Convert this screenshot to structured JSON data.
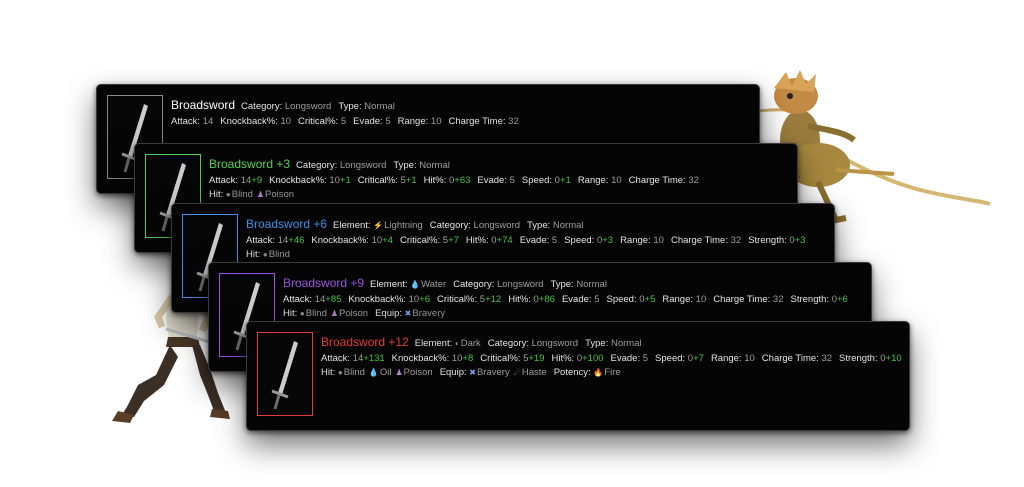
{
  "colors": {
    "bonus": "#43c443",
    "plus0": "#ffffff",
    "plus3": "#4fd14f",
    "plus6": "#3e8fe6",
    "plus9": "#9a52e0",
    "plus12": "#e33b3b"
  },
  "cards": [
    {
      "title": "Broadsword",
      "rarity": "plus0",
      "header": [
        {
          "label": "Category:",
          "value": "Longsword"
        },
        {
          "label": "Type:",
          "value": "Normal"
        }
      ],
      "stats": [
        {
          "label": "Attack:",
          "base": "14"
        },
        {
          "label": "Knockback%:",
          "base": "10"
        },
        {
          "label": "Critical%:",
          "base": "5"
        },
        {
          "label": "Evade:",
          "base": "5"
        },
        {
          "label": "Range:",
          "base": "10"
        },
        {
          "label": "Charge Time:",
          "base": "32"
        }
      ],
      "extras": []
    },
    {
      "title": "Broadsword +3",
      "rarity": "plus3",
      "header": [
        {
          "label": "Category:",
          "value": "Longsword"
        },
        {
          "label": "Type:",
          "value": "Normal"
        }
      ],
      "stats": [
        {
          "label": "Attack:",
          "base": "14",
          "bonus": "+9"
        },
        {
          "label": "Knockback%:",
          "base": "10",
          "bonus": "+1"
        },
        {
          "label": "Critical%:",
          "base": "5",
          "bonus": "+1"
        },
        {
          "label": "Hit%:",
          "base": "0",
          "bonus": "+63"
        },
        {
          "label": "Evade:",
          "base": "5"
        },
        {
          "label": "Speed:",
          "base": "0",
          "bonus": "+1"
        },
        {
          "label": "Range:",
          "base": "10"
        },
        {
          "label": "Charge Time:",
          "base": "32"
        }
      ],
      "extras": [
        {
          "label": "Hit:",
          "items": [
            {
              "icon": "blind-icon",
              "glyph": "●",
              "color": "#8a8a9a",
              "text": "Blind"
            },
            {
              "icon": "poison-icon",
              "glyph": "♟",
              "color": "#b184c8",
              "text": "Poison"
            }
          ]
        }
      ]
    },
    {
      "title": "Broadsword +6",
      "rarity": "plus6",
      "header": [
        {
          "label": "Element:",
          "value": "Lightning",
          "icon": "lightning-icon",
          "glyph": "⚡",
          "color": "#e8d84a"
        },
        {
          "label": "Category:",
          "value": "Longsword"
        },
        {
          "label": "Type:",
          "value": "Normal"
        }
      ],
      "stats": [
        {
          "label": "Attack:",
          "base": "14",
          "bonus": "+46"
        },
        {
          "label": "Knockback%:",
          "base": "10",
          "bonus": "+4"
        },
        {
          "label": "Critical%:",
          "base": "5",
          "bonus": "+7"
        },
        {
          "label": "Hit%:",
          "base": "0",
          "bonus": "+74"
        },
        {
          "label": "Evade:",
          "base": "5"
        },
        {
          "label": "Speed:",
          "base": "0",
          "bonus": "+3"
        },
        {
          "label": "Range:",
          "base": "10"
        },
        {
          "label": "Charge Time:",
          "base": "32"
        },
        {
          "label": "Strength:",
          "base": "0",
          "bonus": "+3"
        }
      ],
      "extras": [
        {
          "label": "Hit:",
          "items": [
            {
              "icon": "blind-icon",
              "glyph": "●",
              "color": "#8a8a9a",
              "text": "Blind"
            }
          ]
        }
      ]
    },
    {
      "title": "Broadsword +9",
      "rarity": "plus9",
      "header": [
        {
          "label": "Element:",
          "value": "Water",
          "icon": "water-icon",
          "glyph": "💧",
          "color": "#5aa8ee"
        },
        {
          "label": "Category:",
          "value": "Longsword"
        },
        {
          "label": "Type:",
          "value": "Normal"
        }
      ],
      "stats": [
        {
          "label": "Attack:",
          "base": "14",
          "bonus": "+85"
        },
        {
          "label": "Knockback%:",
          "base": "10",
          "bonus": "+6"
        },
        {
          "label": "Critical%:",
          "base": "5",
          "bonus": "+12"
        },
        {
          "label": "Hit%:",
          "base": "0",
          "bonus": "+86"
        },
        {
          "label": "Evade:",
          "base": "5"
        },
        {
          "label": "Speed:",
          "base": "0",
          "bonus": "+5"
        },
        {
          "label": "Range:",
          "base": "10"
        },
        {
          "label": "Charge Time:",
          "base": "32"
        },
        {
          "label": "Strength:",
          "base": "0",
          "bonus": "+6"
        }
      ],
      "extras": [
        {
          "label": "Hit:",
          "items": [
            {
              "icon": "blind-icon",
              "glyph": "●",
              "color": "#8a8a9a",
              "text": "Blind"
            },
            {
              "icon": "poison-icon",
              "glyph": "♟",
              "color": "#b184c8",
              "text": "Poison"
            }
          ]
        },
        {
          "label": "Equip:",
          "items": [
            {
              "icon": "bravery-icon",
              "glyph": "✖",
              "color": "#6fa0e8",
              "text": "Bravery"
            }
          ]
        }
      ]
    },
    {
      "title": "Broadsword +12",
      "rarity": "plus12",
      "header": [
        {
          "label": "Element:",
          "value": "Dark",
          "icon": "dark-icon",
          "glyph": "◐",
          "color": "#8c8cc8"
        },
        {
          "label": "Category:",
          "value": "Longsword"
        },
        {
          "label": "Type:",
          "value": "Normal"
        }
      ],
      "stats": [
        {
          "label": "Attack:",
          "base": "14",
          "bonus": "+131"
        },
        {
          "label": "Knockback%:",
          "base": "10",
          "bonus": "+8"
        },
        {
          "label": "Critical%:",
          "base": "5",
          "bonus": "+19"
        },
        {
          "label": "Hit%:",
          "base": "0",
          "bonus": "+100"
        },
        {
          "label": "Evade:",
          "base": "5"
        },
        {
          "label": "Speed:",
          "base": "0",
          "bonus": "+7"
        },
        {
          "label": "Range:",
          "base": "10"
        },
        {
          "label": "Charge Time:",
          "base": "32"
        },
        {
          "label": "Strength:",
          "base": "0",
          "bonus": "+10"
        }
      ],
      "extras": [
        {
          "label": "Hit:",
          "items": [
            {
              "icon": "blind-icon",
              "glyph": "●",
              "color": "#8a8a9a",
              "text": "Blind"
            },
            {
              "icon": "oil-icon",
              "glyph": "💧",
              "color": "#c9c9c9",
              "text": "Oil"
            },
            {
              "icon": "poison-icon",
              "glyph": "♟",
              "color": "#b184c8",
              "text": "Poison"
            }
          ]
        },
        {
          "label": "Equip:",
          "items": [
            {
              "icon": "bravery-icon",
              "glyph": "✖",
              "color": "#6fa0e8",
              "text": "Bravery"
            },
            {
              "icon": "haste-icon",
              "glyph": "☄",
              "color": "#7ab8ee",
              "text": "Haste"
            }
          ]
        },
        {
          "label": "Potency:",
          "items": [
            {
              "icon": "fire-icon",
              "glyph": "🔥",
              "color": "#e04848",
              "text": "Fire"
            }
          ]
        }
      ]
    }
  ]
}
